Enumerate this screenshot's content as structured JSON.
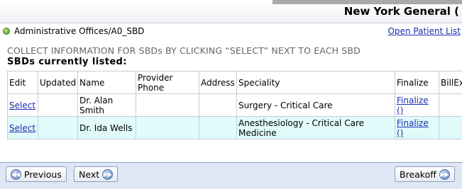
{
  "header": {
    "hospital": "New York General ("
  },
  "breadcrumb": {
    "path": "Administrative Offices/A0_SBD",
    "open_patient_list": "Open Patient List"
  },
  "instruction": "COLLECT INFORMATION FOR SBDs BY CLICKING “SELECT” NEXT TO EACH SBD",
  "listed_title": "SBDs currently listed:",
  "table": {
    "columns": [
      "Edit",
      "Updated",
      "Name",
      "Provider Phone",
      "Address",
      "Speciality",
      "Finalize",
      "BillEx"
    ],
    "rows": [
      {
        "edit": "Select",
        "updated": "",
        "name": "Dr. Alan Smith",
        "phone": "",
        "address": "",
        "speciality": "Surgery - Critical Care",
        "finalize": "Finalize ()",
        "billex": ""
      },
      {
        "edit": "Select",
        "updated": "",
        "name": "Dr. Ida Wells",
        "phone": "",
        "address": "",
        "speciality": "Anesthesiology - Critical Care Medicine",
        "finalize": "Finalize ()",
        "billex": ""
      }
    ]
  },
  "footer": {
    "previous": "Previous",
    "next": "Next",
    "breakoff": "Breakoff"
  }
}
